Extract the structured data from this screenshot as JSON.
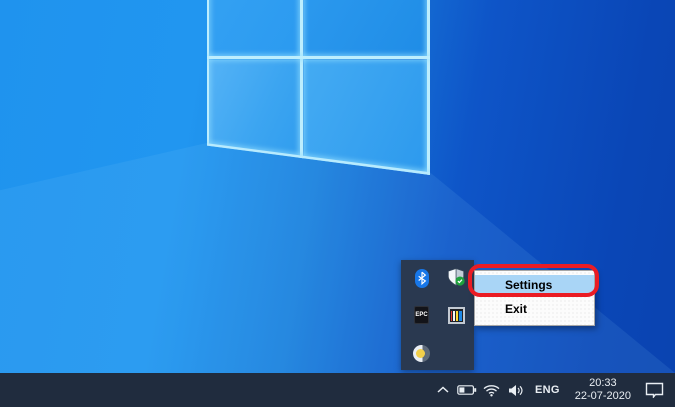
{
  "desktop": {
    "wallpaper_colors": {
      "left_blue": "#1f93ee",
      "right_blue": "#0a46b6",
      "edge_glow": "#bdeefe"
    }
  },
  "tray_popup": {
    "icons": [
      {
        "name": "bluetooth-icon"
      },
      {
        "name": "windows-security-icon"
      },
      {
        "name": "epic-games-icon",
        "text": "EPC"
      },
      {
        "name": "media-app-icon"
      },
      {
        "name": "night-light-icon"
      }
    ]
  },
  "context_menu": {
    "items": [
      {
        "label": "Settings",
        "highlighted": true
      },
      {
        "label": "Exit",
        "highlighted": false
      }
    ],
    "highlight_color": "#a9d5f6",
    "annotation_color": "#ea1c24"
  },
  "taskbar": {
    "language": "ENG",
    "clock": {
      "time": "20:33",
      "date": "22-07-2020"
    },
    "icons": [
      "show-hidden-icons-chevron",
      "battery",
      "wifi",
      "volume",
      "action-center"
    ]
  }
}
